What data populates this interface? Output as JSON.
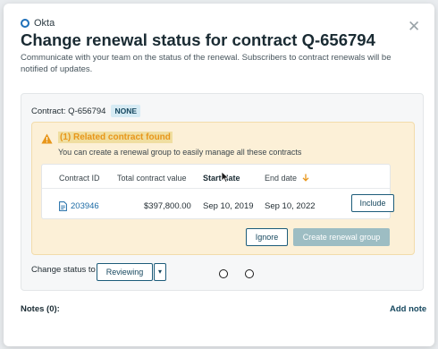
{
  "brand": {
    "name": "Okta"
  },
  "dialog": {
    "title": "Change renewal status for contract Q-656794",
    "description": "Communicate with your team on the status of the renewal. Subscribers to contract renewals will be notified of updates.",
    "close_icon": "close-icon"
  },
  "contract": {
    "label": "Contract: Q-656794",
    "badge": "NONE"
  },
  "warning": {
    "icon": "warning-triangle-icon",
    "title": "(1) Related contract found",
    "subtitle": "You can create a renewal group to easily manage all these contracts"
  },
  "table": {
    "columns": [
      "Contract ID",
      "Total contract value",
      "Start date",
      "End date"
    ],
    "sort_icon": "arrow-down-icon",
    "rows": [
      {
        "id": "203946",
        "value": "$397,800.00",
        "start": "Sep 10, 2019",
        "end": "Sep 10, 2022",
        "action": "Include"
      }
    ]
  },
  "actions": {
    "ignore": "Ignore",
    "create": "Create renewal group"
  },
  "status": {
    "label": "Change status to",
    "selected": "Reviewing"
  },
  "notes": {
    "label": "Notes (0):",
    "add": "Add note"
  },
  "colors": {
    "accent": "#17485f",
    "warning_bg": "#fcf0d7",
    "warning_text": "#e8961a",
    "badge_bg": "#d6ebf4",
    "disabled_btn": "#9dbdc3"
  }
}
